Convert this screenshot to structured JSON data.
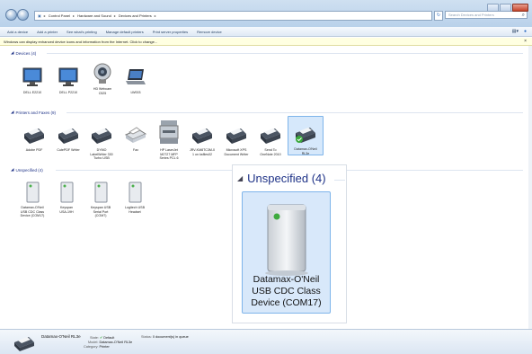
{
  "window": {
    "breadcrumb": [
      "Control Panel",
      "Hardware and Sound",
      "Devices and Printers"
    ],
    "search_placeholder": "Search Devices and Printers"
  },
  "toolbar": {
    "items": [
      "Add a device",
      "Add a printer",
      "See what's printing",
      "Manage default printers",
      "Print server properties",
      "Remove device"
    ]
  },
  "infobar": {
    "text": "Windows can display enhanced device icons and information from the Internet. Click to change..."
  },
  "groups": {
    "devices": {
      "title": "Devices (4)",
      "items": [
        "DELL E2210",
        "DELL P2210",
        "HD Webcam\nC525",
        "LW003"
      ]
    },
    "printers": {
      "title": "Printers and Faxes (9)",
      "items": [
        "Adobe PDF",
        "CutePDF Writer",
        "DYMO\nLabelWriter 330\nTurbo USB",
        "Fax",
        "HP LaserJet\nM2727 MFP\nSeries PCL 6",
        "JRV-KM8TC3M-0\n1 on ksfiles02",
        "Microsoft XPS\nDocument Writer",
        "Send To\nOneNote 2010",
        "Datamax-O'Neil\nRL3e"
      ]
    },
    "unspecified": {
      "title": "Unspecified (4)",
      "items": [
        "Datamax-O'Neil\nUSB CDC Class\nDevice (COM17)",
        "Keyspan\nUSA-19H",
        "Keyspan USB\nSerial Port\n(COM7)",
        "Logitech USB\nHeadset"
      ]
    }
  },
  "zoom": {
    "title": "Unspecified (4)",
    "label": "Datamax-O'Neil USB CDC Class Device (COM17)"
  },
  "details": {
    "name": "Datamax-O'Neil RL3e",
    "state_label": "State:",
    "state_value": "Default",
    "status_label": "Status:",
    "status_value": "0 document(s) in queue",
    "model_label": "Model:",
    "model_value": "Datamax-O'Neil RL3e",
    "category_label": "Category:",
    "category_value": "Printer"
  }
}
